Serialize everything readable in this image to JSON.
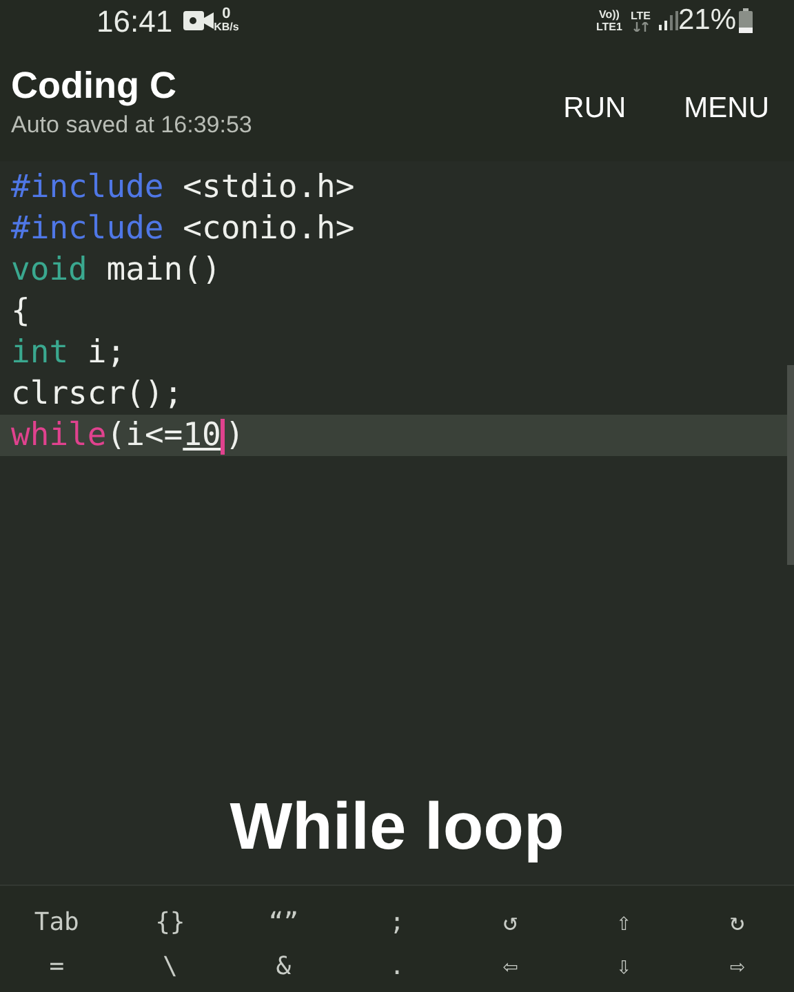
{
  "status_bar": {
    "time": "16:41",
    "speed_value": "0",
    "speed_unit": "KB/s",
    "volte_top": "Vo))",
    "volte_bottom": "LTE1",
    "network": "LTE",
    "battery": "21%"
  },
  "app_bar": {
    "title": "Coding C",
    "subtitle": "Auto saved at 16:39:53",
    "actions": [
      "RUN",
      "MENU"
    ]
  },
  "editor": {
    "lines": [
      {
        "current": false,
        "tokens": [
          {
            "kind": "directive",
            "text": "#include"
          },
          {
            "kind": "plain",
            "text": " <stdio.h>"
          }
        ]
      },
      {
        "current": false,
        "tokens": [
          {
            "kind": "directive",
            "text": "#include"
          },
          {
            "kind": "plain",
            "text": " <conio.h>"
          }
        ]
      },
      {
        "current": false,
        "tokens": [
          {
            "kind": "type",
            "text": "void"
          },
          {
            "kind": "plain",
            "text": " main()"
          }
        ]
      },
      {
        "current": false,
        "tokens": [
          {
            "kind": "plain",
            "text": "{"
          }
        ]
      },
      {
        "current": false,
        "tokens": [
          {
            "kind": "type",
            "text": "int"
          },
          {
            "kind": "plain",
            "text": " i;"
          }
        ]
      },
      {
        "current": false,
        "tokens": [
          {
            "kind": "plain",
            "text": "clrscr();"
          }
        ]
      },
      {
        "current": true,
        "tokens": [
          {
            "kind": "control",
            "text": "while"
          },
          {
            "kind": "plain",
            "text": "(i<="
          },
          {
            "kind": "number",
            "text": "10",
            "cursor": true
          },
          {
            "kind": "plain",
            "text": ")"
          }
        ]
      }
    ]
  },
  "caption": "While loop",
  "key_rows": [
    [
      "Tab",
      "{}",
      "“”",
      ";",
      "↺",
      "⇧",
      "↻"
    ],
    [
      "=",
      "\\",
      "&",
      ".",
      "⇦",
      "⇩",
      "⇨"
    ]
  ]
}
